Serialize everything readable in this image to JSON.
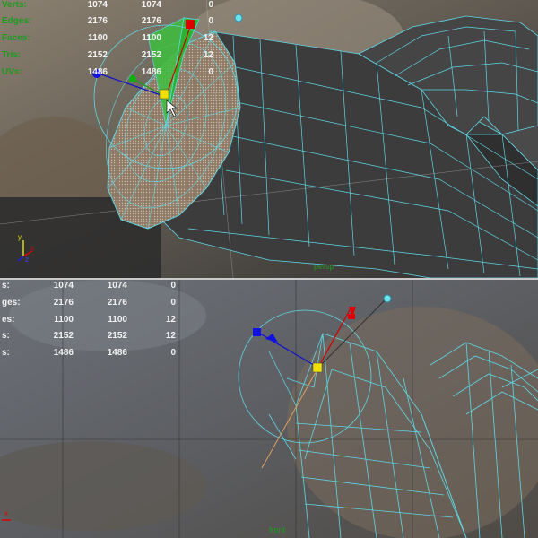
{
  "top_view": {
    "hud_rows": [
      {
        "label": "Verts:",
        "c1": "1074",
        "c2": "1074",
        "c3": "0"
      },
      {
        "label": "Edges:",
        "c1": "2176",
        "c2": "2176",
        "c3": "0"
      },
      {
        "label": "Faces:",
        "c1": "1100",
        "c2": "1100",
        "c3": "12"
      },
      {
        "label": "Tris:",
        "c1": "2152",
        "c2": "2152",
        "c3": "12"
      },
      {
        "label": "UVs:",
        "c1": "1486",
        "c2": "1486",
        "c3": "0"
      }
    ],
    "camera_label": "persp",
    "axis": {
      "x": "x",
      "y": "y",
      "z": "z"
    }
  },
  "bottom_view": {
    "hud_rows": [
      {
        "label": "s:",
        "c1": "1074",
        "c2": "1074",
        "c3": "0"
      },
      {
        "label": "ges:",
        "c1": "2176",
        "c2": "2176",
        "c3": "0"
      },
      {
        "label": "es:",
        "c1": "1100",
        "c2": "1100",
        "c3": "12"
      },
      {
        "label": "s:",
        "c1": "2152",
        "c2": "2152",
        "c3": "12"
      },
      {
        "label": "s:",
        "c1": "1486",
        "c2": "1486",
        "c3": "0"
      }
    ],
    "camera_label": "front",
    "axis": {
      "x": "x"
    }
  },
  "colors": {
    "wire": "#5fd7e6",
    "hud_label": "#1f9a1f",
    "mesh_dark": "#3c3c3c",
    "selected_face": "#2db32d"
  }
}
